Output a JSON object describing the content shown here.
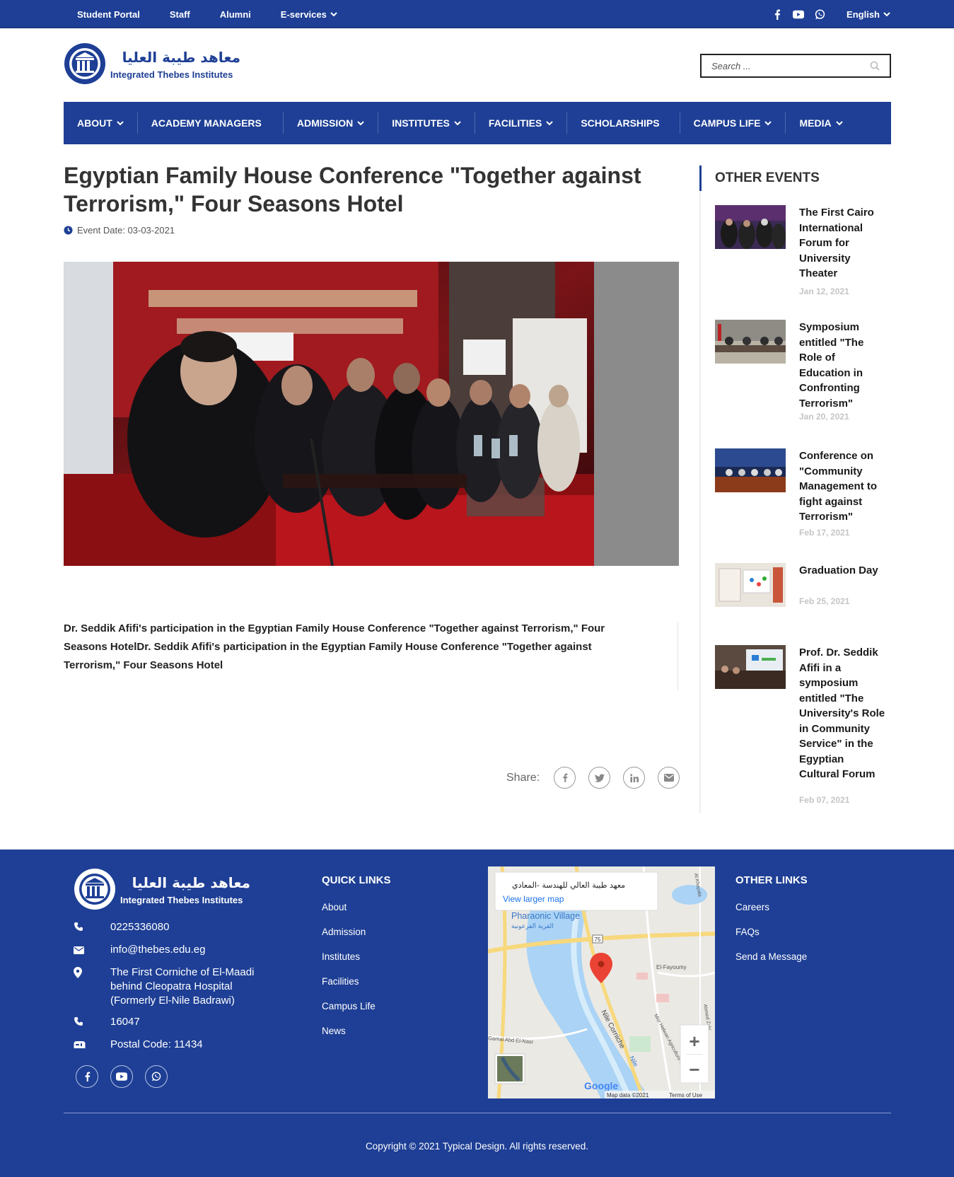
{
  "topbar": {
    "links": [
      "Student Portal",
      "Staff",
      "Alumni",
      "E-services"
    ],
    "language": "English"
  },
  "header": {
    "logo_arabic": "معاهد طيبة العليا",
    "logo_english": "Integrated Thebes Institutes",
    "search_placeholder": "Search ..."
  },
  "nav": {
    "items": [
      "ABOUT",
      "ACADEMY MANAGERS",
      "ADMISSION",
      "INSTITUTES",
      "FACILITIES",
      "SCHOLARSHIPS",
      "CAMPUS LIFE",
      "MEDIA"
    ]
  },
  "article": {
    "title": "Egyptian Family House Conference \"Together against Terrorism,\" Four Seasons Hotel",
    "event_date": "Event Date: 03-03-2021",
    "description": "Dr. Seddik Afifi's participation in the Egyptian Family House Conference \"Together against Terrorism,\" Four Seasons HotelDr. Seddik Afifi's participation in the Egyptian Family House Conference \"Together against Terrorism,\" Four Seasons Hotel",
    "share_label": "Share:"
  },
  "sidebar": {
    "heading": "OTHER EVENTS",
    "events": [
      {
        "title": "The First Cairo International Forum for University Theater",
        "date": "Jan 12, 2021"
      },
      {
        "title": "Symposium entitled \"The Role of Education in Confronting Terrorism\"",
        "date": "Jan 20, 2021"
      },
      {
        "title": "Conference on \"Community Management to fight against Terrorism\"",
        "date": "Feb 17, 2021"
      },
      {
        "title": "Graduation Day",
        "date": "Feb 25, 2021"
      },
      {
        "title": "Prof. Dr. Seddik Afifi in a symposium entitled \"The University's Role in Community Service\" in the Egyptian Cultural Forum",
        "date": "Feb 07, 2021"
      }
    ]
  },
  "footer": {
    "phone": "0225336080",
    "email": "info@thebes.edu.eg",
    "address": "The First Corniche of El-Maadi behind Cleopatra Hospital (Formerly El-Nile Badrawi)",
    "hotline": "16047",
    "postal": "Postal Code: 11434",
    "quick_links_title": "QUICK LINKS",
    "quick_links": [
      "About",
      "Admission",
      "Institutes",
      "Facilities",
      "Campus Life",
      "News"
    ],
    "other_links_title": "OTHER LINKS",
    "other_links": [
      "Careers",
      "FAQs",
      "Send a Message"
    ],
    "map": {
      "place_name": "معهد طيبة العالي للهندسة -المعادي",
      "view_larger": "View larger map",
      "label_village": "Pharaonic Village",
      "label_village_ar": "القرية الفرعونية",
      "label_road": "75",
      "label_fayoumy": "El-Fayoumy",
      "label_corniche": "Nile Corniche",
      "label_nile": "Nile",
      "label_google": "Google",
      "label_mapdata": "Map data ©2021",
      "label_terms": "Terms of Use",
      "label_gamal": "Gamal Abd El-Nasr",
      "label_agri": "Misr Helwan Agriculture Rd",
      "label_ahmed_zaki": "Ahmed Zaki",
      "label_alkhayala": "Al Khayala",
      "zoom_in": "+",
      "zoom_out": "−"
    },
    "copyright": "Copyright © 2021 Typical Design. All rights reserved."
  },
  "colors": {
    "brand_blue": "#1e3f95",
    "sidebar_date": "#c5c5c5"
  }
}
